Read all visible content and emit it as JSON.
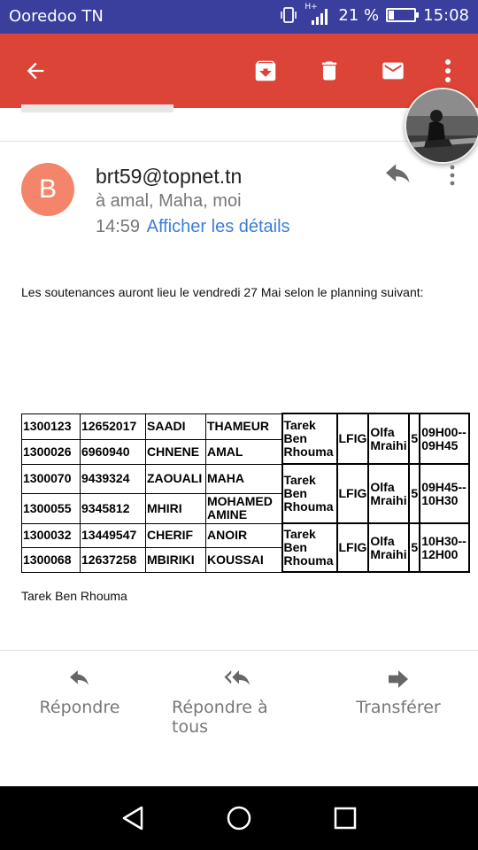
{
  "status_bar": {
    "carrier": "Ooredoo TN",
    "network": "H+",
    "battery_percent": "21 %",
    "battery_level": 0.21,
    "time": "15:08"
  },
  "toolbar": {
    "color": "#db4437",
    "icons": [
      "back-arrow-icon",
      "archive-icon",
      "delete-icon",
      "mark-unread-icon",
      "more-vert-icon"
    ]
  },
  "email": {
    "avatar_letter": "B",
    "avatar_color": "#f5856a",
    "sender": "brt59@topnet.tn",
    "recipients": "à amal, Maha, moi",
    "time": "14:59",
    "details_link": "Afficher les détails",
    "body": "Les soutenances auront lieu le vendredi 27 Mai selon le planning suivant:",
    "signature": "Tarek Ben Rhouma",
    "schedule": [
      {
        "students": [
          {
            "id": "1300123",
            "cin": "12652017",
            "last": "SAADI",
            "first": "THAMEUR"
          },
          {
            "id": "1300026",
            "cin": "6960940",
            "last": "CHNENE",
            "first": "AMAL"
          }
        ],
        "supervisor": "Tarek Ben Rhouma",
        "program": "LFIG",
        "jury": "Olfa Mraihi",
        "room": "5",
        "slot": "09H00--09H45"
      },
      {
        "students": [
          {
            "id": "1300070",
            "cin": "9439324",
            "last": "ZAOUALI",
            "first": "MAHA"
          },
          {
            "id": "1300055",
            "cin": "9345812",
            "last": "MHIRI",
            "first": "MOHAMED AMINE"
          }
        ],
        "supervisor": "Tarek Ben Rhouma",
        "program": "LFIG",
        "jury": "Olfa Mraihi",
        "room": "5",
        "slot": "09H45--10H30"
      },
      {
        "students": [
          {
            "id": "1300032",
            "cin": "13449547",
            "last": "CHERIF",
            "first": "ANOIR"
          },
          {
            "id": "1300068",
            "cin": "12637258",
            "last": "MBIRIKI",
            "first": "KOUSSAI"
          }
        ],
        "supervisor": "Tarek Ben Rhouma",
        "program": "LFIG",
        "jury": "Olfa Mraihi",
        "room": "5",
        "slot": "10H30--12H00"
      }
    ]
  },
  "actions": {
    "reply": "Répondre",
    "reply_all": "Répondre à tous",
    "forward": "Transférer"
  }
}
